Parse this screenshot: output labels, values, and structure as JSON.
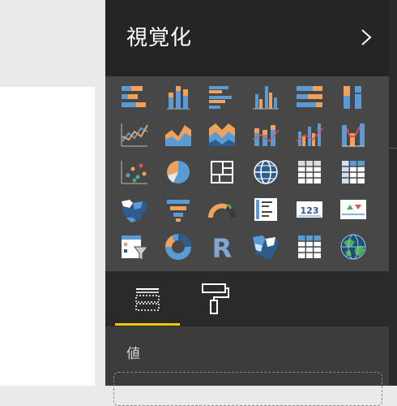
{
  "pane": {
    "title": "視覚化",
    "well_label": "値"
  },
  "colors": {
    "blue": "#5b9bd5",
    "orange": "#f0a25a",
    "dark_blue": "#2e5c8f",
    "red": "#d9534f",
    "green": "#4bae4f",
    "yellow_tab": "#f2c80f"
  },
  "gallery": {
    "table_matrix_label": "123"
  },
  "tabs": [
    {
      "name": "fields-tab"
    },
    {
      "name": "format-tab"
    }
  ]
}
